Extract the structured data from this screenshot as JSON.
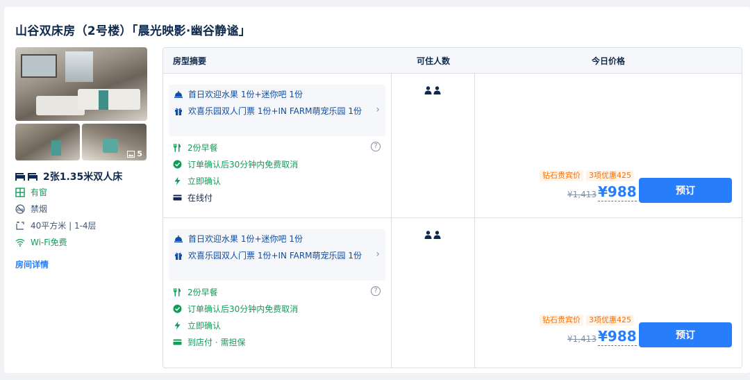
{
  "room": {
    "title": "山谷双床房（2号楼）「晨光映影·幽谷静谧」",
    "photo_count": "5",
    "bed": "2张1.35米双人床",
    "amenities": [
      "有窗",
      "禁烟",
      "40平方米 | 1-4层",
      "Wi-Fi免费"
    ],
    "detail_link": "房间详情"
  },
  "table": {
    "headers": [
      "房型摘要",
      "可住人数",
      "今日价格"
    ],
    "rows": [
      {
        "pkg1": "首日欢迎水果 1份+迷你吧 1份",
        "pkg2": "欢喜乐园双人门票 1份+IN FARM萌宠乐园 1份",
        "breakfast": "2份早餐",
        "cancel": "订单确认后30分钟内免费取消",
        "confirm": "立即确认",
        "payment": "在线付",
        "badge1": "钻石贵宾价",
        "badge2": "3项优惠425",
        "price_old": "¥1,413",
        "price_new": "¥988",
        "book": "预订"
      },
      {
        "pkg1": "首日欢迎水果 1份+迷你吧 1份",
        "pkg2": "欢喜乐园双人门票 1份+IN FARM萌宠乐园 1份",
        "breakfast": "2份早餐",
        "cancel": "订单确认后30分钟内免费取消",
        "confirm": "立即确认",
        "payment": "到店付 · 需担保",
        "badge1": "钻石贵宾价",
        "badge2": "3项优惠425",
        "price_old": "¥1,413",
        "price_new": "¥988",
        "book": "预订"
      }
    ]
  },
  "colors": {
    "accent": "#287dfa",
    "green": "#0f9d58",
    "promo": "#ff6f00",
    "text": "#0f294d"
  },
  "icons": [
    "bed-icon",
    "window-icon",
    "no-smoking-icon",
    "area-icon",
    "wifi-icon",
    "gift-icon",
    "fork-knife-icon",
    "check-circle-icon",
    "lightning-icon",
    "card-icon",
    "question-icon",
    "person-icon",
    "image-icon",
    "chevron-right-icon",
    "cloche-icon"
  ]
}
